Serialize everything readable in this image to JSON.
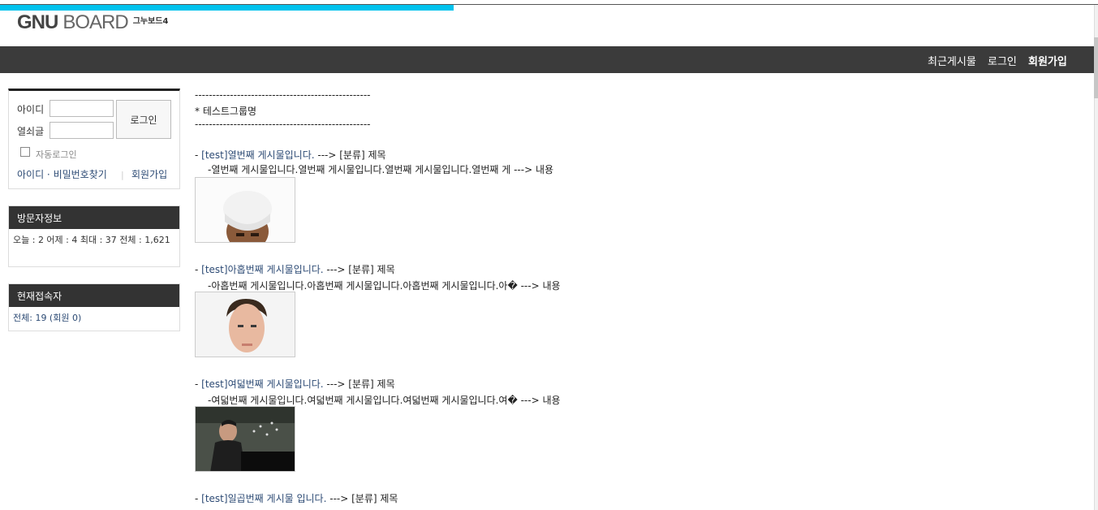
{
  "logo": {
    "brand_bold": "GNU",
    "brand_light": "BOARD",
    "sub": "그누보드4"
  },
  "nav": {
    "recent": "최근게시물",
    "login": "로그인",
    "signup": "회원가입"
  },
  "progress": {
    "fraction": 0.413
  },
  "login_box": {
    "id_label": "아이디",
    "pw_label": "열쇠글",
    "id_value": "",
    "pw_value": "",
    "login_button": "로그인",
    "auto_login": "자동로그인",
    "find_link": "아이디 · 비밀번호찾기",
    "separator": "|",
    "signup_link": "회원가입"
  },
  "visitor": {
    "title": "방문자정보",
    "stats": "오늘 : 2 어제 : 4 최대 : 37 전체 : 1,621"
  },
  "connect": {
    "title": "현재접속자",
    "text": "전체: 19 (회원 0)"
  },
  "main": {
    "divider": "--------------------------------------------------",
    "group_name": "* 테스트그룹명",
    "posts": [
      {
        "prefix": "- ",
        "title": "[test]열번째 게시물입니다.",
        "category_label": " ---> [분류] 제목",
        "content": "-열번째 게시물입니다.열번째 게시물입니다.열번째 게시물입니다.열번째 게 ---> 내용"
      },
      {
        "prefix": "- ",
        "title": "[test]아홉번째 게시물입니다.",
        "category_label": " ---> [분류] 제목",
        "content": "-아홉번째 게시물입니다.아홉번째 게시물입니다.아홉번째 게시물입니다.아� ---> 내용"
      },
      {
        "prefix": "- ",
        "title": "[test]여덟번째 게시물입니다.",
        "category_label": " ---> [분류] 제목",
        "content": "-여덟번째 게시물입니다.여덟번째 게시물입니다.여덟번째 게시물입니다.여� ---> 내용"
      },
      {
        "prefix": "- ",
        "title": "[test]일곱번째 게시물 입니다.",
        "category_label": " ---> [분류] 제목"
      }
    ]
  }
}
